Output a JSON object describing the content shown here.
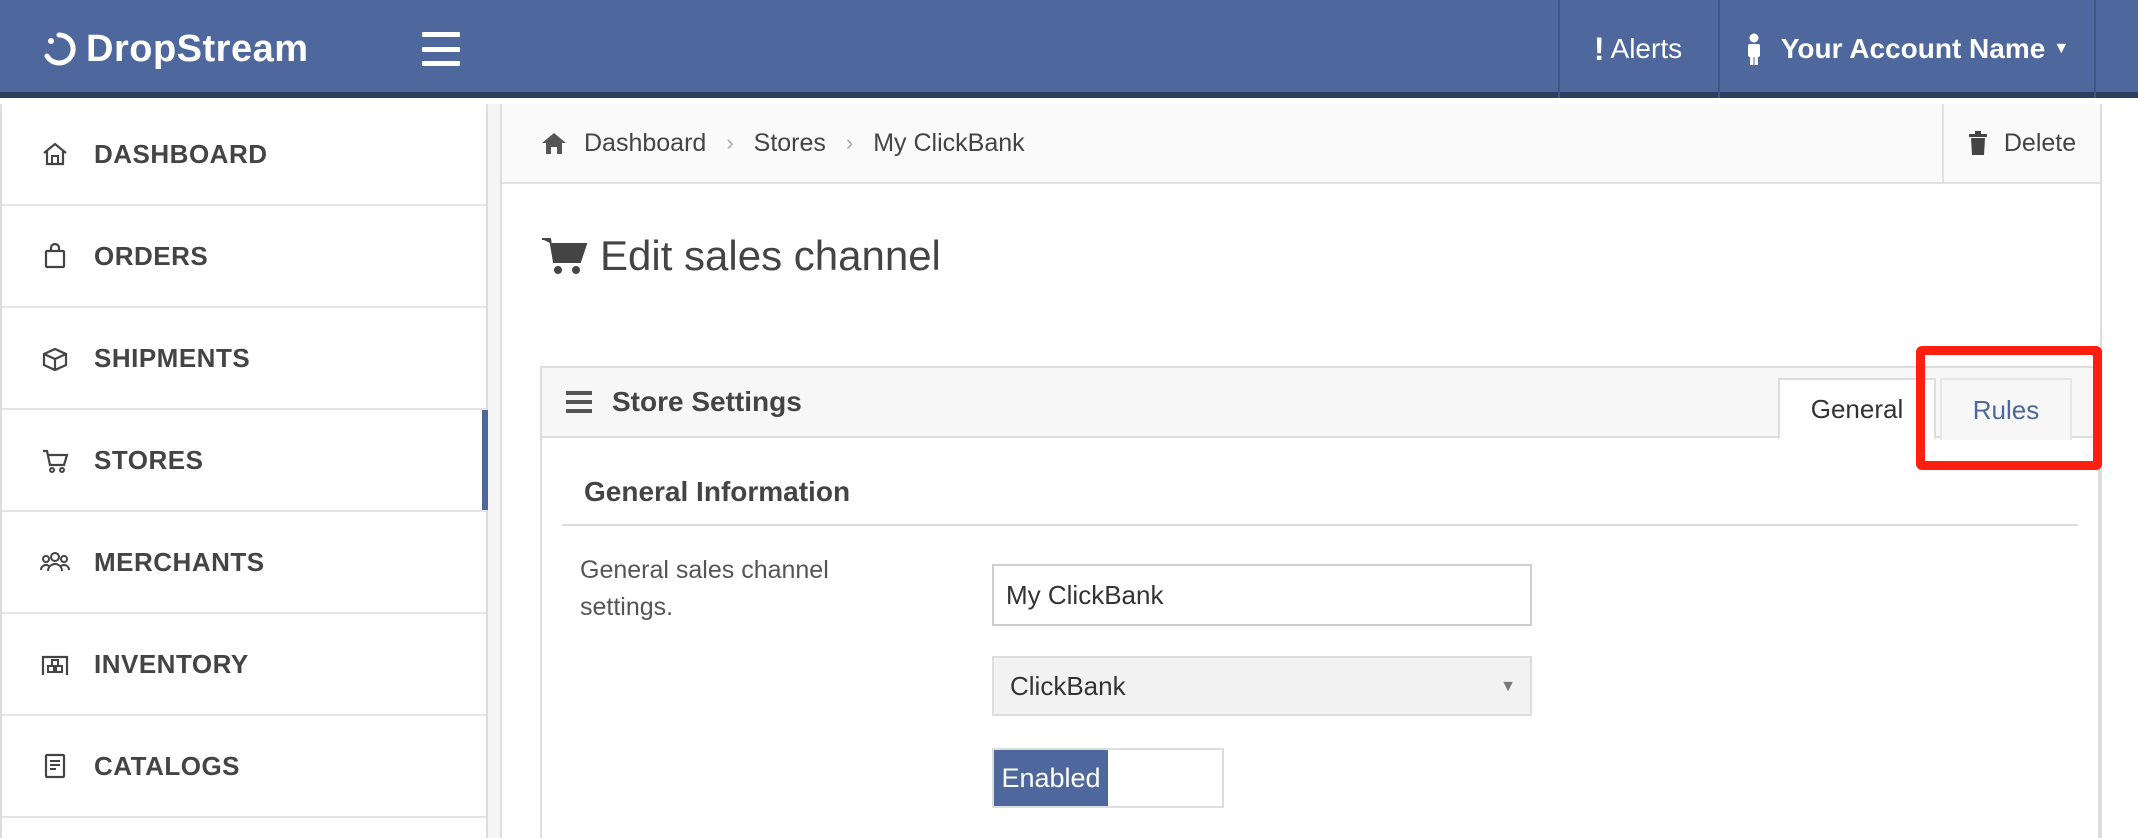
{
  "header": {
    "brand": "DropStream",
    "alerts_label": "Alerts",
    "account_label": "Your Account Name"
  },
  "sidebar": {
    "items": [
      {
        "label": "DASHBOARD",
        "icon": "home-icon",
        "active": false
      },
      {
        "label": "ORDERS",
        "icon": "shopping-bag-icon",
        "active": false
      },
      {
        "label": "SHIPMENTS",
        "icon": "box-icon",
        "active": false
      },
      {
        "label": "STORES",
        "icon": "cart-icon",
        "active": true
      },
      {
        "label": "MERCHANTS",
        "icon": "users-icon",
        "active": false
      },
      {
        "label": "INVENTORY",
        "icon": "warehouse-icon",
        "active": false
      },
      {
        "label": "CATALOGS",
        "icon": "book-icon",
        "active": false
      }
    ]
  },
  "breadcrumb": {
    "items": [
      "Dashboard",
      "Stores",
      "My ClickBank"
    ],
    "delete_label": "Delete"
  },
  "page": {
    "title": "Edit sales channel"
  },
  "panel": {
    "title": "Store Settings",
    "tabs": [
      {
        "label": "General",
        "active": true
      },
      {
        "label": "Rules",
        "active": false
      }
    ],
    "section_title": "General Information",
    "help_text": "General sales channel settings.",
    "name_value": "My ClickBank",
    "platform_value": "ClickBank",
    "toggle_label": "Enabled"
  },
  "colors": {
    "brand": "#4e689e",
    "highlight": "#ff1f0f"
  }
}
